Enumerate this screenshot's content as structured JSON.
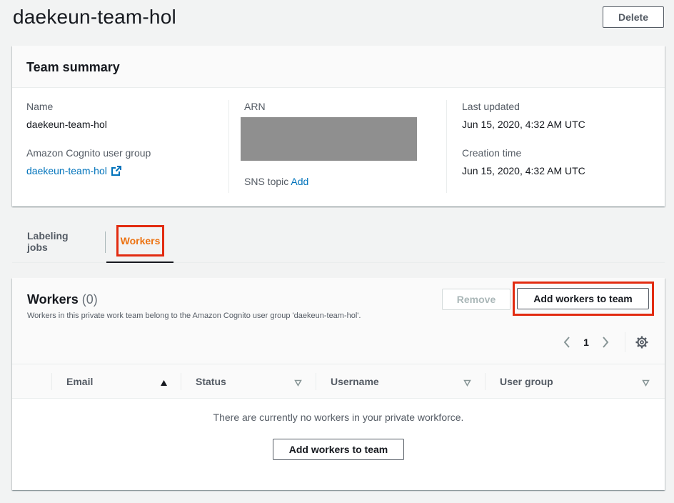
{
  "page": {
    "title": "daekeun-team-hol",
    "delete_label": "Delete"
  },
  "summary": {
    "header": "Team summary",
    "name_label": "Name",
    "name_value": "daekeun-team-hol",
    "cognito_label": "Amazon Cognito user group",
    "cognito_link": "daekeun-team-hol",
    "arn_label": "ARN",
    "sns_label": "SNS topic",
    "sns_add": "Add",
    "last_updated_label": "Last updated",
    "last_updated_value": "Jun 15, 2020, 4:32 AM UTC",
    "creation_label": "Creation time",
    "creation_value": "Jun 15, 2020, 4:32 AM UTC"
  },
  "tabs": [
    {
      "label": "Labeling jobs",
      "active": false
    },
    {
      "label": "Workers",
      "active": true
    }
  ],
  "workers": {
    "title": "Workers",
    "count": "(0)",
    "description": "Workers in this private work team belong to the Amazon Cognito user group 'daekeun-team-hol'.",
    "remove_label": "Remove",
    "add_label": "Add workers to team",
    "page_number": "1",
    "columns": [
      "Email",
      "Status",
      "Username",
      "User group"
    ],
    "empty_message": "There are currently no workers in your private workforce.",
    "empty_add_label": "Add workers to team"
  },
  "colors": {
    "accent": "#ec7211",
    "link": "#0073bb",
    "highlight": "#e22b10"
  },
  "icons": [
    "external-link-icon",
    "chevron-left-icon",
    "chevron-right-icon",
    "gear-icon",
    "sort-ascending-icon",
    "sort-descending-icon"
  ]
}
